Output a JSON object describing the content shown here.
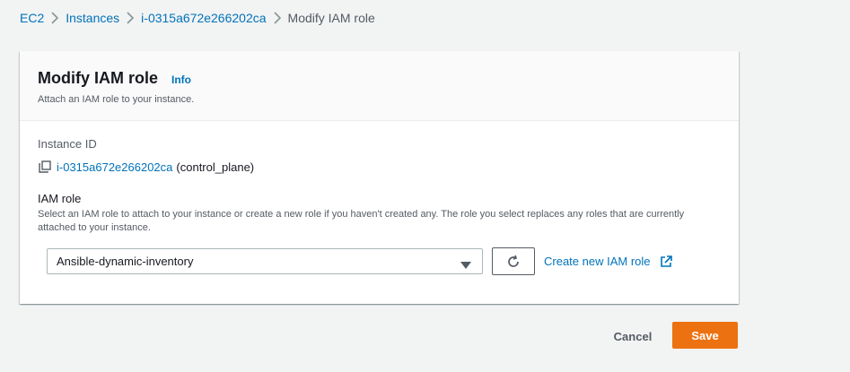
{
  "breadcrumb": {
    "items": [
      "EC2",
      "Instances",
      "i-0315a672e266202ca"
    ],
    "current": "Modify IAM role"
  },
  "panel": {
    "title": "Modify IAM role",
    "info_label": "Info",
    "description": "Attach an IAM role to your instance."
  },
  "instance": {
    "label": "Instance ID",
    "id": "i-0315a672e266202ca",
    "name": "(control_plane)",
    "copy_icon": "copy-icon"
  },
  "iam_role": {
    "label": "IAM role",
    "description": "Select an IAM role to attach to your instance or create a new role if you haven't created any. The role you select replaces any roles that are currently attached to your instance.",
    "selected": "Ansible-dynamic-inventory",
    "refresh_icon": "refresh-icon",
    "create_link": "Create new IAM role",
    "external_icon": "external-link-icon"
  },
  "actions": {
    "cancel": "Cancel",
    "save": "Save"
  },
  "colors": {
    "link": "#0073bb",
    "primary": "#ec7211",
    "background": "#f2f3f3"
  }
}
